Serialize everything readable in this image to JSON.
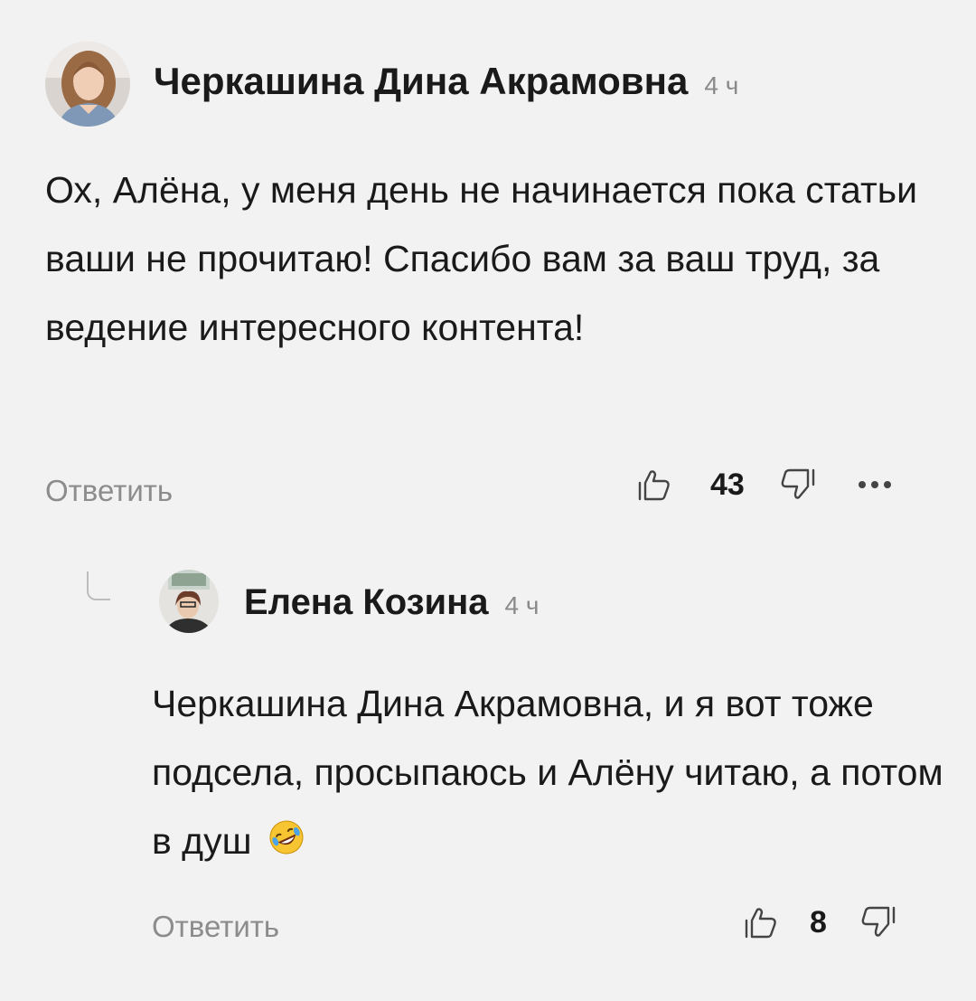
{
  "comment": {
    "author": "Черкашина Дина Акрамовна",
    "time": "4 ч",
    "text": "Ох, Алёна, у меня день не начинается пока статьи ваши не прочитаю! Спасибо вам за ваш труд, за ведение интересного контента!",
    "reply_label": "Ответить",
    "likes": "43",
    "icons": {
      "like": "thumbs-up-icon",
      "dislike": "thumbs-down-icon",
      "more": "more-dots-icon"
    }
  },
  "reply": {
    "author": "Елена Козина",
    "time": "4 ч",
    "text": "Черкашина Дина Акрамовна, и я вот тоже подсела, просыпаюсь и Алёну читаю, а потом в душ",
    "emoji": "rolling-on-floor-laughing-emoji",
    "reply_label": "Ответить",
    "likes": "8"
  },
  "colors": {
    "background": "#f2f2f2",
    "text": "#1a1a1a",
    "muted": "#8a8a8a"
  }
}
